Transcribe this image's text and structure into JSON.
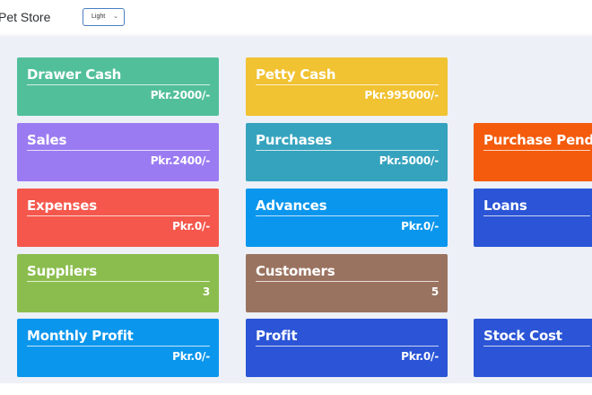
{
  "header": {
    "app_title": "Pet Store",
    "theme_select": {
      "selected": "Light"
    }
  },
  "cards": [
    {
      "title": "Drawer Cash",
      "value": "Pkr.2000/-",
      "color": "#52bf9b"
    },
    {
      "title": "Petty Cash",
      "value": "Pkr.995000/-",
      "color": "#f1c232"
    },
    {
      "title": "Sales",
      "value": "Pkr.2400/-",
      "color": "#9b7bf2"
    },
    {
      "title": "Purchases",
      "value": "Pkr.5000/-",
      "color": "#36a3be"
    },
    {
      "title": "Purchase Pending",
      "value": "",
      "color": "#f45b0c"
    },
    {
      "title": "Expenses",
      "value": "Pkr.0/-",
      "color": "#f5574c"
    },
    {
      "title": "Advances",
      "value": "Pkr.0/-",
      "color": "#0b96ed"
    },
    {
      "title": "Loans",
      "value": "",
      "color": "#2b55d6"
    },
    {
      "title": "Suppliers",
      "value": "3",
      "color": "#8bbd4e"
    },
    {
      "title": "Customers",
      "value": "5",
      "color": "#9a7360"
    },
    {
      "title": "Monthly Profit",
      "value": "Pkr.0/-",
      "color": "#0b96ed"
    },
    {
      "title": "Profit",
      "value": "Pkr.0/-",
      "color": "#2b55d6"
    },
    {
      "title": "Stock Cost",
      "value": "",
      "color": "#2b55d6"
    }
  ]
}
